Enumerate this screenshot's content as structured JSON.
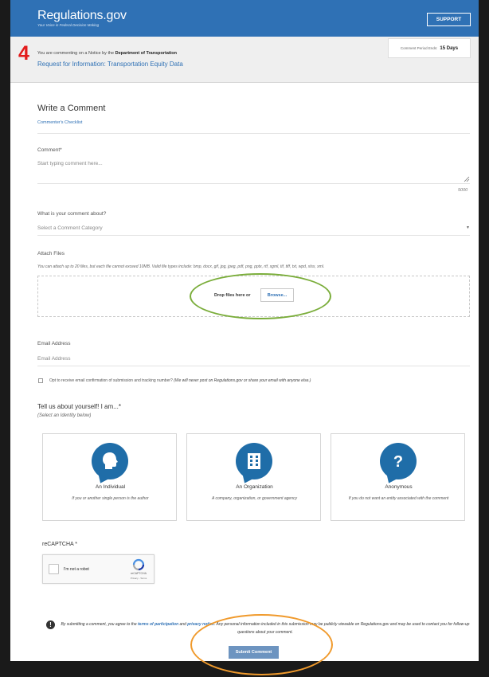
{
  "header": {
    "logo": "Regulations.gov",
    "tagline": "Your Voice in Federal Decision Making",
    "support_label": "SUPPORT"
  },
  "notice": {
    "step": "4",
    "prefix": "You are commenting on a Notice by the ",
    "agency": "Department of Transportation",
    "title": "Request for Information: Transportation Equity Data",
    "period_label": "Comment Period Ends:",
    "period_value": "15 Days"
  },
  "form": {
    "title": "Write a Comment",
    "checklist_link": "Commenter's Checklist",
    "comment_label": "Comment*",
    "comment_placeholder": "Start typing comment here...",
    "char_count": "5000",
    "category_label": "What is your comment about?",
    "category_placeholder": "Select a Comment Category",
    "attach_label": "Attach Files",
    "attach_help": "You can attach up to 20 files, but each file cannot exceed 10MB. Valid file types include: bmp, docx, gif, jpg, jpeg, pdf, png, pptx, rtf, sgml, tif, tiff, txt, wpd, xlsx, xml.",
    "drop_text": "Drop files here or",
    "browse_label": "Browse...",
    "email_label": "Email Address",
    "email_placeholder": "Email Address",
    "optin_text": "Opt to receive email confirmation of submission and tracking number?",
    "optin_note": "(We will never post on Regulations.gov or share your email with anyone else.)",
    "identity_title": "Tell us about yourself! I am...*",
    "identity_sub": "(Select an Identity below)",
    "identities": [
      {
        "title": "An Individual",
        "desc": "If you or another single person is the author"
      },
      {
        "title": "An Organization",
        "desc": "A company, organization, or government agency"
      },
      {
        "title": "Anonymous",
        "desc": "If you do not want an entity associated with the comment"
      }
    ],
    "captcha_label": "reCAPTCHA *",
    "captcha_text": "I'm not a robot",
    "captcha_brand": "reCAPTCHA",
    "captcha_links": "Privacy - Terms",
    "disclaimer_pre": "By submitting a comment, you agree to the ",
    "terms_link": "terms of participation",
    "disclaimer_and": " and ",
    "privacy_link": "privacy notice",
    "disclaimer_post": ". Any personal information included in this submission may be publicly viewable on Regulations.gov and may be used to contact you for follow-up questions about your comment.",
    "submit_label": "Submit Comment"
  },
  "colors": {
    "brand_blue": "#2f71b5",
    "step_red": "#e31b1b",
    "highlight_green": "#7aad3a",
    "highlight_orange": "#f09a2c"
  }
}
